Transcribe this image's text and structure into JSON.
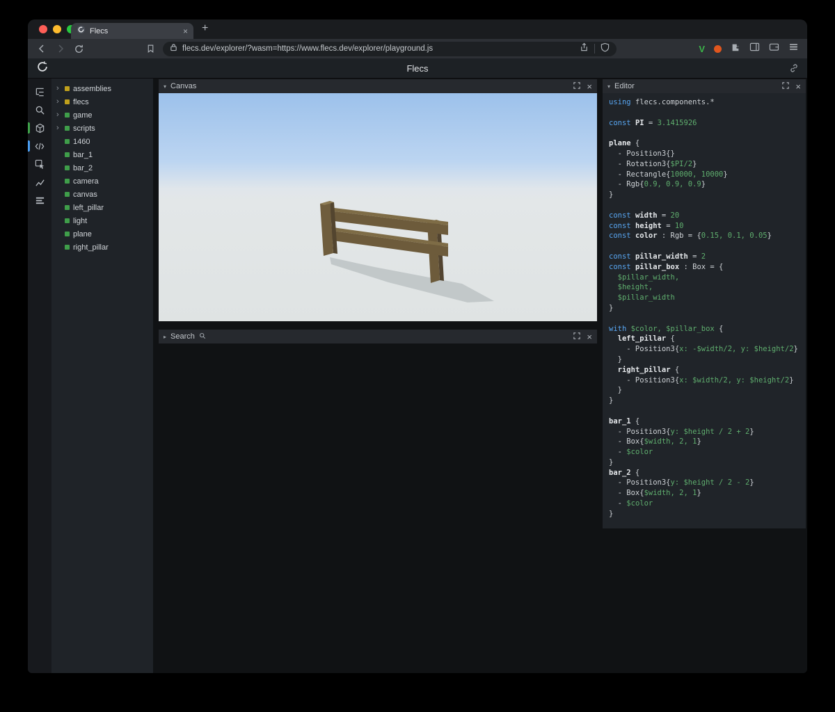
{
  "browser": {
    "tab_title": "Flecs",
    "url": "flecs.dev/explorer/?wasm=https://www.flecs.dev/explorer/playground.js"
  },
  "header": {
    "title": "Flecs"
  },
  "sidebar": {
    "icons": [
      {
        "name": "hierarchy-icon",
        "icon": "hierarchy"
      },
      {
        "name": "search-icon",
        "icon": "search"
      },
      {
        "name": "scene-icon",
        "icon": "cube",
        "indicator": "#3fa24a"
      },
      {
        "name": "code-icon",
        "icon": "code",
        "indicator": "#4a9df0"
      },
      {
        "name": "inspect-icon",
        "icon": "inspect"
      },
      {
        "name": "chart-icon",
        "icon": "chart"
      },
      {
        "name": "stats-icon",
        "icon": "rows"
      }
    ]
  },
  "tree": {
    "items": [
      {
        "label": "assemblies",
        "expandable": true,
        "color": "#c0a01c"
      },
      {
        "label": "flecs",
        "expandable": true,
        "color": "#c0a01c"
      },
      {
        "label": "game",
        "expandable": true,
        "color": "#3f9e4a"
      },
      {
        "label": "scripts",
        "expandable": true,
        "color": "#3f9e4a"
      },
      {
        "label": "1460",
        "expandable": false,
        "color": "#3f9e4a"
      },
      {
        "label": "bar_1",
        "expandable": false,
        "color": "#3f9e4a"
      },
      {
        "label": "bar_2",
        "expandable": false,
        "color": "#3f9e4a"
      },
      {
        "label": "camera",
        "expandable": false,
        "color": "#3f9e4a"
      },
      {
        "label": "canvas",
        "expandable": false,
        "color": "#3f9e4a"
      },
      {
        "label": "left_pillar",
        "expandable": false,
        "color": "#3f9e4a"
      },
      {
        "label": "light",
        "expandable": false,
        "color": "#3f9e4a"
      },
      {
        "label": "plane",
        "expandable": false,
        "color": "#3f9e4a"
      },
      {
        "label": "right_pillar",
        "expandable": false,
        "color": "#3f9e4a"
      }
    ]
  },
  "panels": {
    "canvas": {
      "title": "Canvas"
    },
    "search": {
      "title": "Search"
    },
    "editor": {
      "title": "Editor",
      "code_lines": [
        [
          [
            "k",
            "using "
          ],
          [
            "p",
            "flecs.components.*"
          ]
        ],
        [],
        [
          [
            "k",
            "const "
          ],
          [
            "b",
            "PI"
          ],
          [
            "p",
            " = "
          ],
          [
            "g",
            "3.1415926"
          ]
        ],
        [],
        [
          [
            "b",
            "plane"
          ],
          [
            "p",
            " {"
          ]
        ],
        [
          [
            "p",
            "  - Position3{}"
          ]
        ],
        [
          [
            "p",
            "  - Rotation3{"
          ],
          [
            "g",
            "$PI/2"
          ],
          [
            "p",
            "}"
          ]
        ],
        [
          [
            "p",
            "  - Rectangle{"
          ],
          [
            "g",
            "10000, 10000"
          ],
          [
            "p",
            "}"
          ]
        ],
        [
          [
            "p",
            "  - Rgb{"
          ],
          [
            "g",
            "0.9, 0.9, 0.9"
          ],
          [
            "p",
            "}"
          ]
        ],
        [
          [
            "p",
            "}"
          ]
        ],
        [],
        [
          [
            "k",
            "const "
          ],
          [
            "b",
            "width"
          ],
          [
            "p",
            " = "
          ],
          [
            "g",
            "20"
          ]
        ],
        [
          [
            "k",
            "const "
          ],
          [
            "b",
            "height"
          ],
          [
            "p",
            " = "
          ],
          [
            "g",
            "10"
          ]
        ],
        [
          [
            "k",
            "const "
          ],
          [
            "b",
            "color"
          ],
          [
            "p",
            " : Rgb = {"
          ],
          [
            "g",
            "0.15, 0.1, 0.05"
          ],
          [
            "p",
            "}"
          ]
        ],
        [],
        [
          [
            "k",
            "const "
          ],
          [
            "b",
            "pillar_width"
          ],
          [
            "p",
            " = "
          ],
          [
            "g",
            "2"
          ]
        ],
        [
          [
            "k",
            "const "
          ],
          [
            "b",
            "pillar_box"
          ],
          [
            "p",
            " : Box = {"
          ]
        ],
        [
          [
            "g",
            "  $pillar_width,"
          ]
        ],
        [
          [
            "g",
            "  $height,"
          ]
        ],
        [
          [
            "g",
            "  $pillar_width"
          ]
        ],
        [
          [
            "p",
            "}"
          ]
        ],
        [],
        [
          [
            "k",
            "with "
          ],
          [
            "g",
            "$color, $pillar_box"
          ],
          [
            "p",
            " {"
          ]
        ],
        [
          [
            "p",
            "  "
          ],
          [
            "b",
            "left_pillar"
          ],
          [
            "p",
            " {"
          ]
        ],
        [
          [
            "p",
            "    - Position3{"
          ],
          [
            "g",
            "x: -$width/2, y: $height/2"
          ],
          [
            "p",
            "}"
          ]
        ],
        [
          [
            "p",
            "  }"
          ]
        ],
        [
          [
            "p",
            "  "
          ],
          [
            "b",
            "right_pillar"
          ],
          [
            "p",
            " {"
          ]
        ],
        [
          [
            "p",
            "    - Position3{"
          ],
          [
            "g",
            "x: $width/2, y: $height/2"
          ],
          [
            "p",
            "}"
          ]
        ],
        [
          [
            "p",
            "  }"
          ]
        ],
        [
          [
            "p",
            "}"
          ]
        ],
        [],
        [
          [
            "b",
            "bar_1"
          ],
          [
            "p",
            " {"
          ]
        ],
        [
          [
            "p",
            "  - Position3{"
          ],
          [
            "g",
            "y: $height / 2 + 2"
          ],
          [
            "p",
            "}"
          ]
        ],
        [
          [
            "p",
            "  - Box{"
          ],
          [
            "g",
            "$width, 2, 1"
          ],
          [
            "p",
            "}"
          ]
        ],
        [
          [
            "p",
            "  - "
          ],
          [
            "g",
            "$color"
          ]
        ],
        [
          [
            "p",
            "}"
          ]
        ],
        [
          [
            "b",
            "bar_2"
          ],
          [
            "p",
            " {"
          ]
        ],
        [
          [
            "p",
            "  - Position3{"
          ],
          [
            "g",
            "y: $height / 2 - 2"
          ],
          [
            "p",
            "}"
          ]
        ],
        [
          [
            "p",
            "  - Box{"
          ],
          [
            "g",
            "$width, 2, 1"
          ],
          [
            "p",
            "}"
          ]
        ],
        [
          [
            "p",
            "  - "
          ],
          [
            "g",
            "$color"
          ]
        ],
        [
          [
            "p",
            "}"
          ]
        ]
      ]
    }
  }
}
